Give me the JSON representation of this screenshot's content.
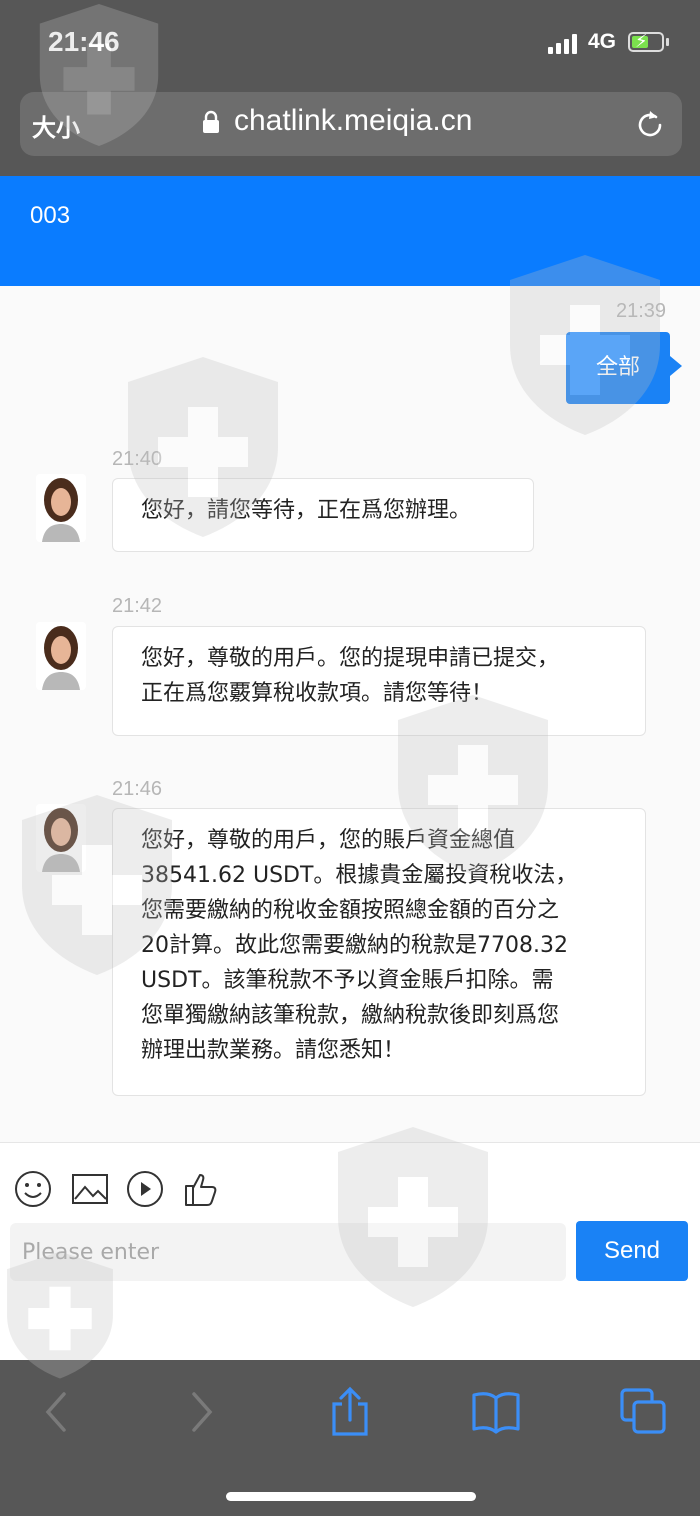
{
  "status_bar": {
    "time": "21:46",
    "network": "4G"
  },
  "browser": {
    "text_size_label": "大小",
    "url": "chatlink.meiqia.cn"
  },
  "chat": {
    "title": "003"
  },
  "messages": {
    "user": {
      "time": "21:39",
      "text": "全部"
    },
    "agent": [
      {
        "time": "21:40",
        "text": "您好，請您等待，正在爲您辦理。"
      },
      {
        "time": "21:42",
        "text": "您好，尊敬的用戶。您的提現申請已提交，\n正在爲您覈算稅收款項。請您等待！"
      },
      {
        "time": "21:46",
        "text": "您好，尊敬的用戶，您的賬戶資金總值\n38541.62 USDT。根據貴金屬投資稅收法，\n您需要繳納的稅收金額按照總金額的百分之\n20計算。故此您需要繳納的稅款是7708.32\nUSDT。該筆稅款不予以資金賬戶扣除。需\n您單獨繳納該筆稅款，繳納稅款後即刻爲您\n辦理出款業務。請您悉知！"
      }
    ]
  },
  "composer": {
    "placeholder": "Please enter",
    "send_label": "Send",
    "tools": [
      "emoji-icon",
      "image-icon",
      "video-icon",
      "thumbs-up-icon"
    ]
  },
  "toolbar": {
    "icons": [
      "back-icon",
      "forward-icon",
      "share-icon",
      "bookmarks-icon",
      "tabs-icon"
    ]
  },
  "colors": {
    "accent": "#0a7cff",
    "browser_chrome": "#575757",
    "bubble_border": "#e3e3e3"
  }
}
